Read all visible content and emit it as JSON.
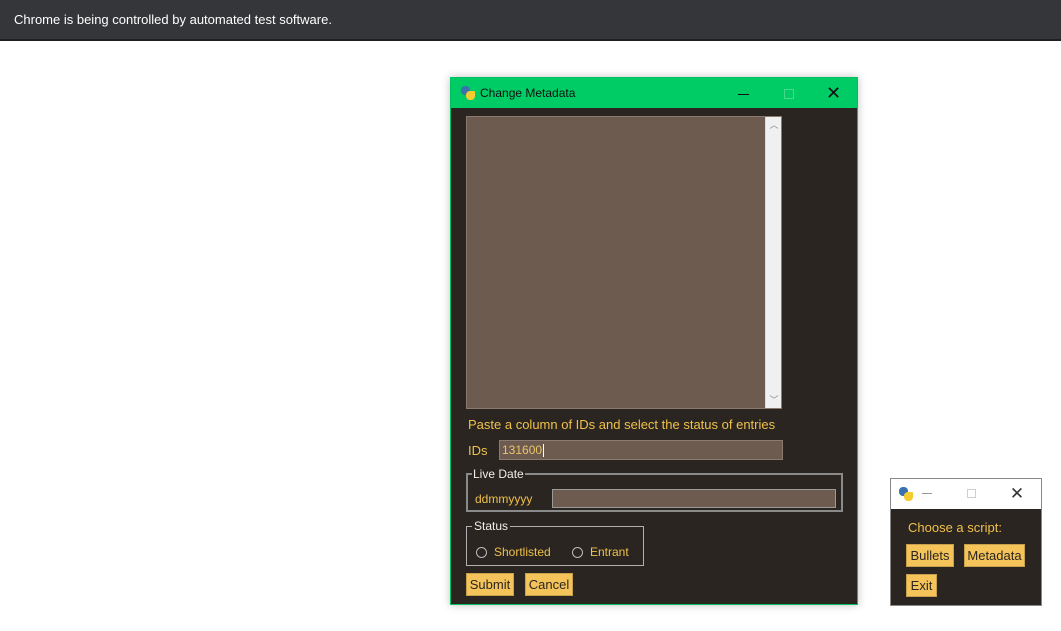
{
  "infobar": {
    "text": "Chrome is being controlled by automated test software."
  },
  "metadata_window": {
    "title": "Change Metadata",
    "title_icon": "python-icon",
    "controls": {
      "minimize": "minimize-icon",
      "maximize": "maximize-icon",
      "close": "✕"
    },
    "ids_textarea": {
      "value": ""
    },
    "instruction": "Paste a column of IDs and select the status of entries",
    "ids": {
      "label": "IDs",
      "value": "131600"
    },
    "live_date": {
      "legend": "Live Date",
      "label": "ddmmyyyy",
      "value": ""
    },
    "status": {
      "legend": "Status",
      "options": [
        "Shortlisted",
        "Entrant"
      ],
      "selected": null
    },
    "buttons": {
      "submit": "Submit",
      "cancel": "Cancel"
    }
  },
  "launcher_window": {
    "title_icon": "python-icon",
    "controls": {
      "minimize": "minimize-icon",
      "maximize": "maximize-icon",
      "close": "✕"
    },
    "prompt": "Choose a script:",
    "buttons": {
      "bullets": "Bullets",
      "metadata": "Metadata",
      "exit": "Exit"
    }
  },
  "colors": {
    "title_bar": "#00cc66",
    "window_bg": "#2a2520",
    "input_bg": "#6e5b4f",
    "label_text": "#f0c04a",
    "button_bg": "#f4c45a"
  }
}
